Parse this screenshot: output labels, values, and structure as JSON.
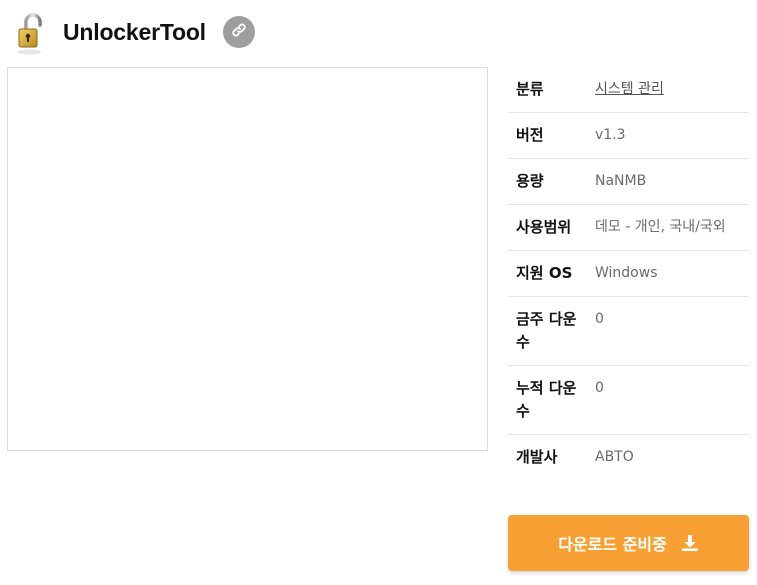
{
  "app": {
    "title": "UnlockerTool"
  },
  "info": {
    "rows": [
      {
        "label": "분류",
        "value": "시스템 관리"
      },
      {
        "label": "버전",
        "value": "v1.3"
      },
      {
        "label": "용량",
        "value": "NaNMB"
      },
      {
        "label": "사용범위",
        "value": "데모 - 개인, 국내/국외"
      },
      {
        "label": "지원 OS",
        "value": "Windows"
      },
      {
        "label": "금주 다운수",
        "value": "0"
      },
      {
        "label": "누적 다운수",
        "value": "0"
      },
      {
        "label": "개발사",
        "value": "ABTO"
      }
    ]
  },
  "download": {
    "label": "다운로드 준비중"
  },
  "icons": {
    "app": "padlock-icon",
    "link": "link-icon",
    "download": "download-icon"
  },
  "colors": {
    "download_button": "#f7a135",
    "link_button": "#9e9e9e"
  }
}
